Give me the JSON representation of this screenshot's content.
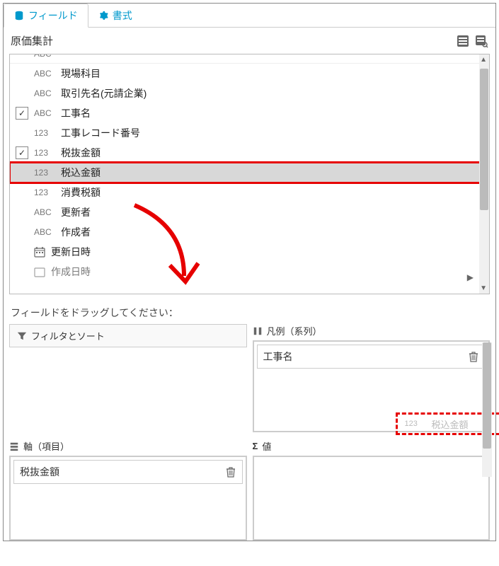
{
  "tabs": {
    "field_label": "フィールド",
    "format_label": "書式"
  },
  "title": "原価集計",
  "fields": {
    "partial_top": {
      "type": "ABC",
      "label": ""
    },
    "items": [
      {
        "idx": 0,
        "type": "ABC",
        "label": "現場科目",
        "checked": false
      },
      {
        "idx": 1,
        "type": "ABC",
        "label": "取引先名(元請企業)",
        "checked": false
      },
      {
        "idx": 2,
        "type": "ABC",
        "label": "工事名",
        "checked": true
      },
      {
        "idx": 3,
        "type": "123",
        "label": "工事レコード番号",
        "checked": false
      },
      {
        "idx": 4,
        "type": "123",
        "label": "税抜金額",
        "checked": true
      },
      {
        "idx": 5,
        "type": "123",
        "label": "税込金額",
        "checked": false,
        "selected": true,
        "highlight": true
      },
      {
        "idx": 6,
        "type": "123",
        "label": "消費税額",
        "checked": false
      },
      {
        "idx": 7,
        "type": "ABC",
        "label": "更新者",
        "checked": false
      },
      {
        "idx": 8,
        "type": "ABC",
        "label": "作成者",
        "checked": false
      },
      {
        "idx": 9,
        "type": "date",
        "label": "更新日時",
        "checked": false
      }
    ],
    "partial_bottom_label": "作成日時"
  },
  "instruction": "フィールドをドラッグしてください：",
  "zones": {
    "filter_sort_label": "フィルタとソート",
    "legend_label": "凡例（系列）",
    "legend_chip": "工事名",
    "axis_label": "軸（項目）",
    "axis_chip": "税抜金額",
    "value_label": "値"
  },
  "ghost": {
    "type": "123",
    "label": "税込金額"
  }
}
